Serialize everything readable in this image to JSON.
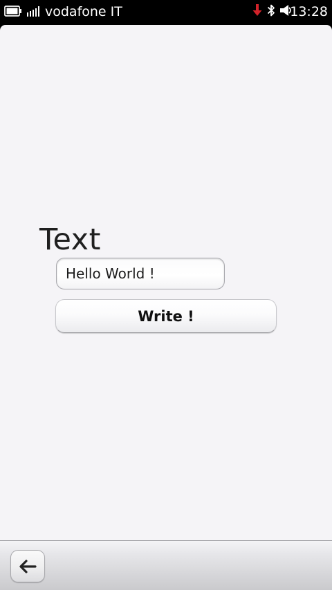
{
  "status_bar": {
    "carrier": "vodafone IT",
    "time": "13:28",
    "icons": {
      "battery": "battery-icon",
      "signal": "signal-strength-icon",
      "download": "download-arrow-icon",
      "bluetooth": "bluetooth-icon",
      "ringer": "speaker-icon"
    },
    "colors": {
      "background": "#000000",
      "text": "#ffffff",
      "download_arrow": "#d2232a"
    }
  },
  "main": {
    "heading": "Text",
    "input": {
      "value": "Hello World !",
      "placeholder": ""
    },
    "write_button_label": "Write !",
    "background_color": "#f5f4f7"
  },
  "toolbar": {
    "back_icon": "back-arrow-icon"
  }
}
